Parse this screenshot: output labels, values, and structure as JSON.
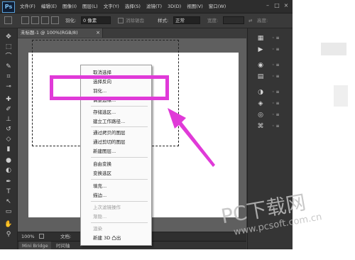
{
  "app": {
    "logo": "Ps",
    "menus": [
      "文件(F)",
      "编辑(E)",
      "图像(I)",
      "图层(L)",
      "文字(Y)",
      "选择(S)",
      "滤镜(T)",
      "3D(D)",
      "视图(V)",
      "窗口(W)"
    ],
    "window_controls": [
      "–",
      "□",
      "×"
    ]
  },
  "options": {
    "feather_label": "羽化:",
    "feather_value": "0 像素",
    "antialias_label": "消除锯齿",
    "style_label": "样式:",
    "style_value": "正常",
    "width_label": "宽度:",
    "height_label": "高度:"
  },
  "document": {
    "tab_title": "未标题-1 @ 100%(RGB/8)",
    "close_icon": "×",
    "zoom": "100%",
    "doc_info": "文档:"
  },
  "context_menu": {
    "items": [
      {
        "label": "取消选择",
        "enabled": true
      },
      {
        "label": "选择反向",
        "enabled": true
      },
      {
        "label": "羽化...",
        "enabled": true
      },
      {
        "label": "调整边缘...",
        "enabled": true
      },
      {
        "label": "存储选区...",
        "enabled": true
      },
      {
        "label": "建立工作路径...",
        "enabled": true
      },
      {
        "label": "通过拷贝的图层",
        "enabled": true
      },
      {
        "label": "通过剪切的图层",
        "enabled": true
      },
      {
        "label": "新建图层...",
        "enabled": true
      },
      {
        "label": "自由变换",
        "enabled": true
      },
      {
        "label": "变换选区",
        "enabled": true
      },
      {
        "label": "填充...",
        "enabled": true
      },
      {
        "label": "描边...",
        "enabled": true
      },
      {
        "label": "上次滤镜操作",
        "enabled": false
      },
      {
        "label": "渐隐...",
        "enabled": false
      },
      {
        "label": "渲染",
        "enabled": false
      },
      {
        "label": "新建 3D 凸出",
        "enabled": true
      }
    ]
  },
  "bottom_tabs": [
    "Mini Bridge",
    "时间轴"
  ],
  "watermark": {
    "main": "PC下载网",
    "url": "www.pcsoft.com.cn"
  },
  "colors": {
    "highlight": "#e03ad8",
    "arrow": "#e03ad8"
  },
  "icons": {
    "tools": [
      "move-icon",
      "marquee-icon",
      "lasso-icon",
      "quick-select-icon",
      "crop-icon",
      "eyedropper-icon",
      "healing-brush-icon",
      "brush-icon",
      "stamp-icon",
      "history-brush-icon",
      "eraser-icon",
      "gradient-icon",
      "blur-icon",
      "dodge-icon",
      "pen-icon",
      "type-icon",
      "path-select-icon",
      "shape-icon",
      "hand-icon",
      "zoom-icon"
    ],
    "panels": [
      "history-icon",
      "actions-icon",
      "color-icon",
      "swatches-icon",
      "adjustments-icon",
      "layers-icon",
      "channels-icon",
      "paths-icon"
    ]
  }
}
